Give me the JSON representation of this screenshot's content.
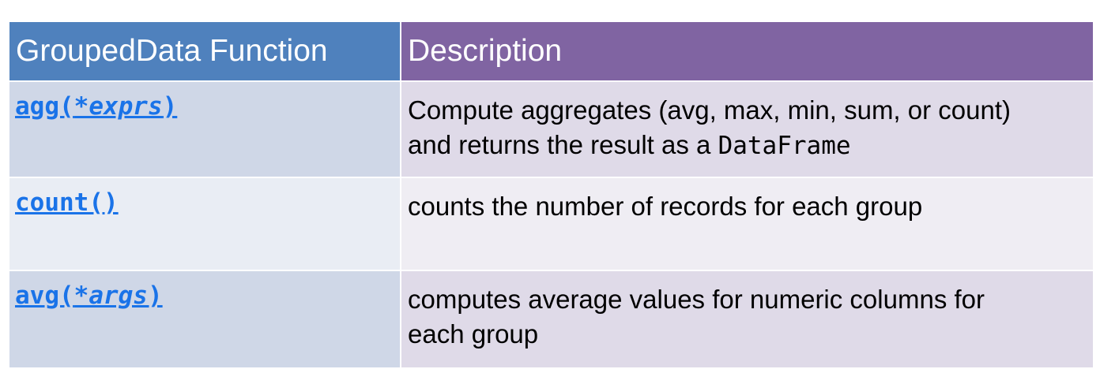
{
  "table": {
    "headers": [
      "GroupedData Function",
      "Description"
    ],
    "rows": [
      {
        "function_name": "agg(",
        "function_arg": "*exprs",
        "function_close": ")",
        "description_line1": "Compute aggregates (avg, max, min, sum, or count)",
        "description_line2_prefix": "and returns the result as a ",
        "description_line2_code": "DataFrame"
      },
      {
        "function_name": "count()",
        "description": "counts the number of records for each group"
      },
      {
        "function_name": "avg(",
        "function_arg": "*args",
        "function_close": ")",
        "description_line1": "computes average values for numeric columns for",
        "description_line2": "each group"
      }
    ]
  }
}
